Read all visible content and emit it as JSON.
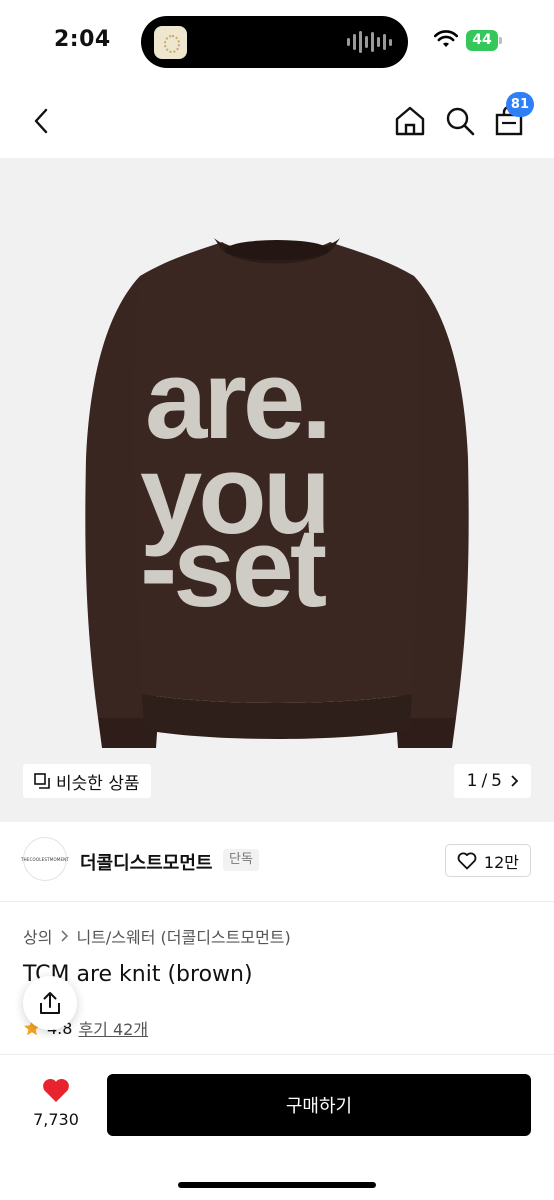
{
  "status": {
    "time": "2:04",
    "battery": "44"
  },
  "nav": {
    "cart_count": "81"
  },
  "hero": {
    "sweater_text": [
      "are.",
      "you",
      "-set"
    ],
    "similar_label": "비슷한 상품",
    "page_current": "1",
    "page_sep": "/",
    "page_total": "5"
  },
  "brand": {
    "logo_text": "THECOOLESTMOMENT",
    "name": "더콜디스트모먼트",
    "tag": "단독",
    "likes": "12만"
  },
  "product": {
    "breadcrumb": [
      "상의",
      "니트/스웨터 (더콜디스트모먼트)"
    ],
    "title": "TCM are knit (brown)",
    "rating": "4.8",
    "reviews": "후기 42개"
  },
  "bottom": {
    "wish_count": "7,730",
    "buy_label": "구매하기"
  },
  "colors": {
    "accent": "#2f80f7",
    "sweater": "#3b2722",
    "heart": "#e8232e",
    "star": "#f5a623"
  }
}
